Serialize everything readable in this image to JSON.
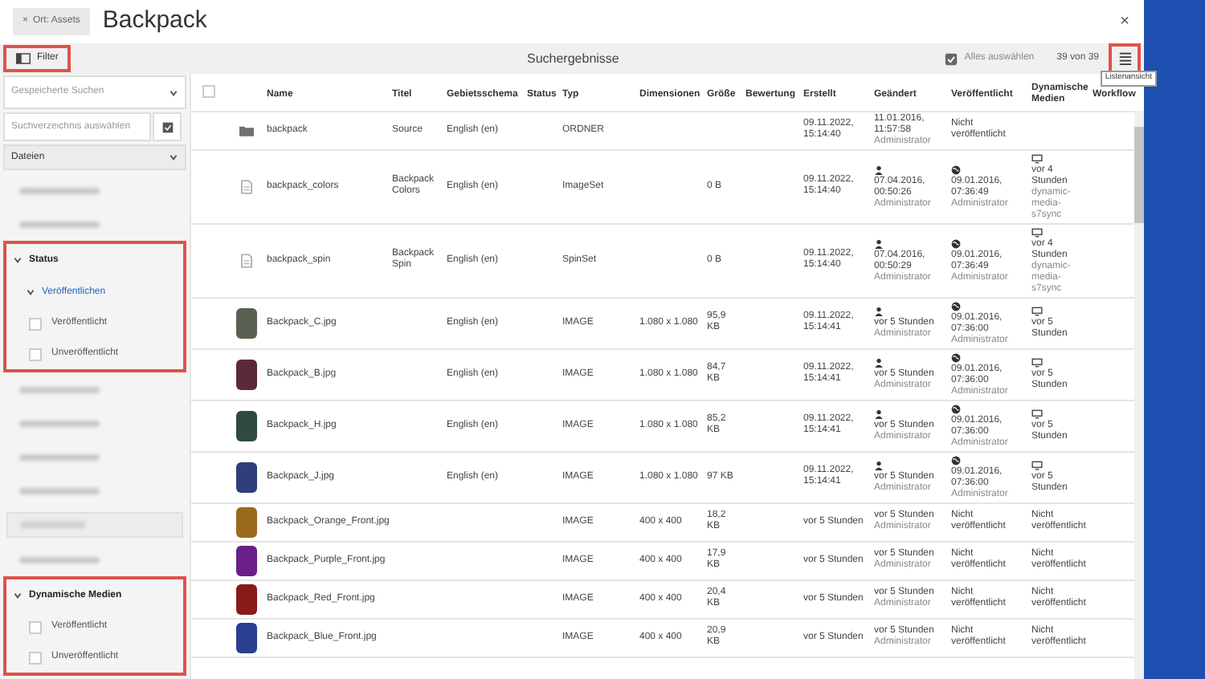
{
  "header": {
    "back_button": "Ort: Assets",
    "back_icon": "×",
    "title": "Backpack",
    "close": "×"
  },
  "toolbar": {
    "filter": {
      "label": "Filter",
      "highlighted": true
    },
    "title": "Suchergebnisse",
    "select_all": "Alles auswählen",
    "count": "39 von 39",
    "view_button": {
      "highlighted": true,
      "tooltip": "Listenansicht"
    }
  },
  "sidebar": {
    "saved_search": {
      "placeholder": "Gespeicherte Suchen"
    },
    "directory": {
      "placeholder": "Suchverzeichnis auswählen"
    },
    "type_select": {
      "value": "Dateien"
    },
    "items": [
      {
        "kind": "blurred"
      },
      {
        "kind": "blurred"
      },
      {
        "kind": "group",
        "label": "Status",
        "expanded": true,
        "highlighted": true,
        "children": [
          {
            "kind": "subgroup",
            "label": "Veröffentlichen",
            "expanded": true,
            "children": [
              {
                "kind": "checkbox",
                "label": "Veröffentlicht",
                "checked": false
              },
              {
                "kind": "checkbox",
                "label": "Unveröffentlicht",
                "checked": false
              }
            ]
          }
        ]
      },
      {
        "kind": "blurred"
      },
      {
        "kind": "blurred"
      },
      {
        "kind": "blurred"
      },
      {
        "kind": "blurred"
      },
      {
        "kind": "blurred_select"
      },
      {
        "kind": "blurred"
      },
      {
        "kind": "group",
        "label": "Dynamische Medien",
        "expanded": true,
        "highlighted": true,
        "children": [
          {
            "kind": "checkbox",
            "label": "Veröffentlicht",
            "checked": false
          },
          {
            "kind": "checkbox",
            "label": "Unveröffentlicht",
            "checked": false
          }
        ]
      }
    ]
  },
  "table": {
    "select_all_checked": false,
    "columns": [
      "Name",
      "Titel",
      "Gebietsschema",
      "Status",
      "Typ",
      "Dimensionen",
      "Größe",
      "Bewertung",
      "Erstellt",
      "Geändert",
      "Veröffentlicht",
      "Dynamische Medien",
      "Workflow"
    ],
    "rows": [
      {
        "kind": "folder",
        "name": "backpack",
        "title": "Source",
        "locale": "English (en)",
        "type": "ORDNER",
        "created": "09.11.2022, 15:14:40",
        "modified": {
          "text": "11.01.2016, 11:57:58",
          "user_icon": false,
          "user": "Administrator"
        },
        "published": {
          "globe_icon": false,
          "text": "Nicht veröffentlicht"
        }
      },
      {
        "kind": "file",
        "name": "backpack_colors",
        "title": "Backpack Colors",
        "locale": "English (en)",
        "type": "ImageSet",
        "size": "0 B",
        "created": "09.11.2022, 15:14:40",
        "modified": {
          "text": "07.04.2016, 00:50:26",
          "user_icon": true,
          "user": "Administrator"
        },
        "published": {
          "globe_icon": true,
          "text": "09.01.2016, 07:36:49",
          "user": "Administrator"
        },
        "dynamic_media": {
          "icon": true,
          "text": "vor 4 Stunden",
          "user": "dynamic-media-s7sync"
        }
      },
      {
        "kind": "file",
        "name": "backpack_spin",
        "title": "Backpack Spin",
        "locale": "English (en)",
        "type": "SpinSet",
        "size": "0 B",
        "created": "09.11.2022, 15:14:40",
        "modified": {
          "text": "07.04.2016, 00:50:29",
          "user_icon": true,
          "user": "Administrator"
        },
        "published": {
          "globe_icon": true,
          "text": "09.01.2016, 07:36:49",
          "user": "Administrator"
        },
        "dynamic_media": {
          "icon": true,
          "text": "vor 4 Stunden",
          "user": "dynamic-media-s7sync"
        }
      },
      {
        "kind": "image",
        "color": "#5b6152",
        "name": "Backpack_C.jpg",
        "locale": "English (en)",
        "type": "IMAGE",
        "dimensions": "1.080 x 1.080",
        "size": "95,9 KB",
        "created": "09.11.2022, 15:14:41",
        "modified": {
          "text": "vor 5 Stunden",
          "user_icon": true,
          "user": "Administrator"
        },
        "published": {
          "globe_icon": true,
          "text": "09.01.2016, 07:36:00",
          "user": "Administrator"
        },
        "dynamic_media": {
          "icon": true,
          "text": "vor 5 Stunden"
        }
      },
      {
        "kind": "image",
        "color": "#5a2a3a",
        "name": "Backpack_B.jpg",
        "locale": "English (en)",
        "type": "IMAGE",
        "dimensions": "1.080 x 1.080",
        "size": "84,7 KB",
        "created": "09.11.2022, 15:14:41",
        "modified": {
          "text": "vor 5 Stunden",
          "user_icon": true,
          "user": "Administrator"
        },
        "published": {
          "globe_icon": true,
          "text": "09.01.2016, 07:36:00",
          "user": "Administrator"
        },
        "dynamic_media": {
          "icon": true,
          "text": "vor 5 Stunden"
        }
      },
      {
        "kind": "image",
        "color": "#2f4a40",
        "name": "Backpack_H.jpg",
        "locale": "English (en)",
        "type": "IMAGE",
        "dimensions": "1.080 x 1.080",
        "size": "85,2 KB",
        "created": "09.11.2022, 15:14:41",
        "modified": {
          "text": "vor 5 Stunden",
          "user_icon": true,
          "user": "Administrator"
        },
        "published": {
          "globe_icon": true,
          "text": "09.01.2016, 07:36:00",
          "user": "Administrator"
        },
        "dynamic_media": {
          "icon": true,
          "text": "vor 5 Stunden"
        }
      },
      {
        "kind": "image",
        "color": "#2e3f7a",
        "name": "Backpack_J.jpg",
        "locale": "English (en)",
        "type": "IMAGE",
        "dimensions": "1.080 x 1.080",
        "size": "97 KB",
        "created": "09.11.2022, 15:14:41",
        "modified": {
          "text": "vor 5 Stunden",
          "user_icon": true,
          "user": "Administrator"
        },
        "published": {
          "globe_icon": true,
          "text": "09.01.2016, 07:36:00",
          "user": "Administrator"
        },
        "dynamic_media": {
          "icon": true,
          "text": "vor 5 Stunden"
        }
      },
      {
        "kind": "image",
        "color": "#9a6a1c",
        "name": "Backpack_Orange_Front.jpg",
        "type": "IMAGE",
        "dimensions": "400 x 400",
        "size": "18,2 KB",
        "created": "vor 5 Stunden",
        "modified": {
          "text": "vor 5 Stunden",
          "user_icon": false,
          "user": "Administrator"
        },
        "published": {
          "globe_icon": false,
          "text": "Nicht veröffentlicht"
        },
        "dynamic_media": {
          "icon": false,
          "text": "Nicht veröffentlicht"
        }
      },
      {
        "kind": "image",
        "color": "#6a1f8a",
        "name": "Backpack_Purple_Front.jpg",
        "type": "IMAGE",
        "dimensions": "400 x 400",
        "size": "17,9 KB",
        "created": "vor 5 Stunden",
        "modified": {
          "text": "vor 5 Stunden",
          "user_icon": false,
          "user": "Administrator"
        },
        "published": {
          "globe_icon": false,
          "text": "Nicht veröffentlicht"
        },
        "dynamic_media": {
          "icon": false,
          "text": "Nicht veröffentlicht"
        }
      },
      {
        "kind": "image",
        "color": "#8a1a1a",
        "name": "Backpack_Red_Front.jpg",
        "type": "IMAGE",
        "dimensions": "400 x 400",
        "size": "20,4 KB",
        "created": "vor 5 Stunden",
        "modified": {
          "text": "vor 5 Stunden",
          "user_icon": false,
          "user": "Administrator"
        },
        "published": {
          "globe_icon": false,
          "text": "Nicht veröffentlicht"
        },
        "dynamic_media": {
          "icon": false,
          "text": "Nicht veröffentlicht"
        }
      },
      {
        "kind": "image",
        "color": "#2a3f8f",
        "name": "Backpack_Blue_Front.jpg",
        "type": "IMAGE",
        "dimensions": "400 x 400",
        "size": "20,9 KB",
        "created": "vor 5 Stunden",
        "modified": {
          "text": "vor 5 Stunden",
          "user_icon": false,
          "user": "Administrator"
        },
        "published": {
          "globe_icon": false,
          "text": "Nicht veröffentlicht"
        },
        "dynamic_media": {
          "icon": false,
          "text": "Nicht veröffentlicht"
        }
      }
    ]
  }
}
